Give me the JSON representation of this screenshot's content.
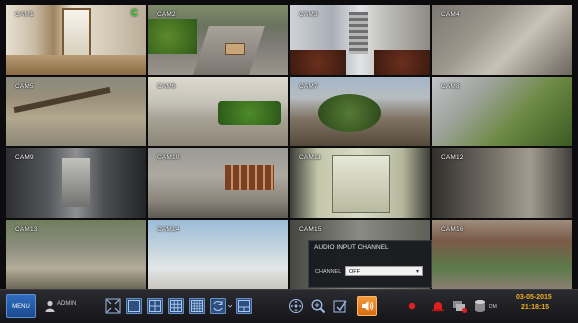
{
  "cameras": [
    {
      "label": "CAM1"
    },
    {
      "label": "CAM2"
    },
    {
      "label": "CAM3"
    },
    {
      "label": "CAM4"
    },
    {
      "label": "CAM5"
    },
    {
      "label": "CAM6"
    },
    {
      "label": "CAM7"
    },
    {
      "label": "CAM8"
    },
    {
      "label": "CAM9"
    },
    {
      "label": "CAM10"
    },
    {
      "label": "CAM11"
    },
    {
      "label": "CAM12"
    },
    {
      "label": "CAM13"
    },
    {
      "label": "CAM14"
    },
    {
      "label": "CAM15"
    },
    {
      "label": "CAM16"
    }
  ],
  "cam1_status_icon": "C",
  "audio_popup": {
    "title": "AUDIO INPUT CHANNEL",
    "channel_label": "CHANNEL",
    "channel_value": "OFF"
  },
  "toolbar": {
    "menu_label": "MENU",
    "user_label": "ADMIN",
    "dm_label": "DM",
    "date": "03-05-2015",
    "time": "21:18:15",
    "icons": [
      "fullscreen-icon",
      "layout-1-icon",
      "layout-4-icon",
      "layout-9-icon",
      "layout-16-icon",
      "sequence-icon",
      "layout-custom-icon",
      "ptz-icon",
      "zoom-icon",
      "freeze-icon",
      "audio-icon",
      "record-icon",
      "alarm-icon",
      "event-icon",
      "storage-icon"
    ]
  },
  "colors": {
    "accent_blue": "#2f6dbf",
    "audio_orange": "#e8831f",
    "clock_yellow": "#f0b020",
    "record_red": "#e02020"
  }
}
